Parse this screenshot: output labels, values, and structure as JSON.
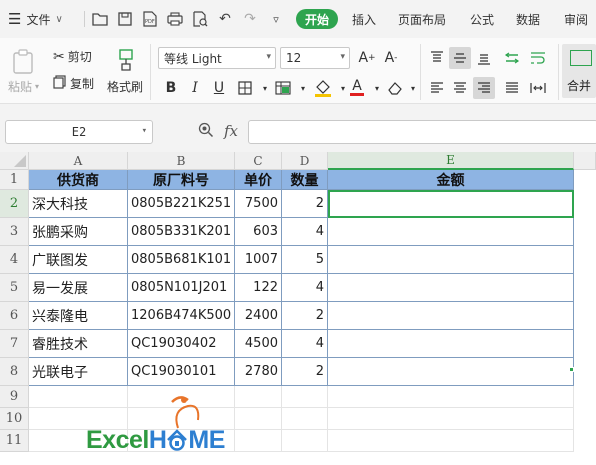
{
  "menubar": {
    "file_label": "文件",
    "tabs": [
      "开始",
      "插入",
      "页面布局",
      "公式",
      "数据",
      "审阅"
    ]
  },
  "ribbon": {
    "paste_label": "粘贴",
    "cut_label": "剪切",
    "copy_label": "复制",
    "format_painter_label": "格式刷",
    "font_name": "等线 Light",
    "font_size": "12",
    "merge_label": "合并"
  },
  "formula_bar": {
    "name_box": "E2",
    "fx_label": "fx",
    "formula": ""
  },
  "sheet": {
    "columns": [
      "A",
      "B",
      "C",
      "D",
      "E"
    ],
    "rows": [
      "1",
      "2",
      "3",
      "4",
      "5",
      "6",
      "7",
      "8",
      "9",
      "10",
      "11"
    ],
    "active_cell": "E2",
    "headers": [
      "供货商",
      "原厂料号",
      "单价",
      "数量",
      "金额"
    ],
    "data": [
      [
        "深大科技",
        "0805B221K251",
        "7500",
        "2",
        ""
      ],
      [
        "张鹏采购",
        "0805B331K201",
        "603",
        "4",
        ""
      ],
      [
        "广联图发",
        "0805B681K101",
        "1007",
        "5",
        ""
      ],
      [
        "易一发展",
        "0805N101J201",
        "122",
        "4",
        ""
      ],
      [
        "兴泰隆电",
        "1206B474K500",
        "2400",
        "2",
        ""
      ],
      [
        "睿胜技术",
        "QC19030402",
        "4500",
        "4",
        ""
      ],
      [
        "光联电子",
        "QC19030101",
        "2780",
        "2",
        ""
      ]
    ]
  },
  "logo": {
    "part1": "Excel",
    "part2": "H",
    "part3": "ME"
  },
  "colors": {
    "accent_green": "#2ea44f",
    "header_fill": "#8eb4e3",
    "logo_green": "#2f9a41",
    "logo_blue": "#2d7fd1"
  }
}
